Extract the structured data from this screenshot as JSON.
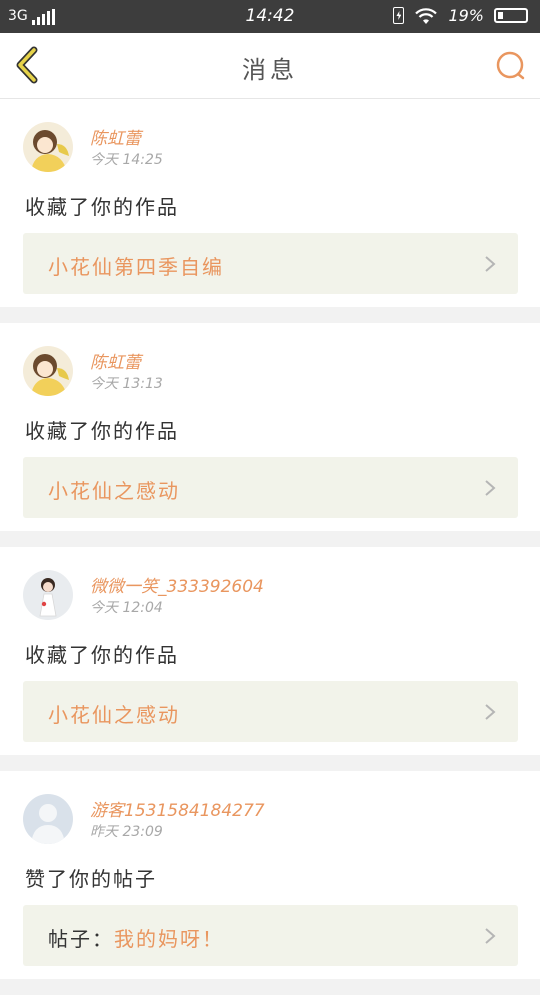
{
  "status_bar": {
    "network": "3G",
    "time": "14:42",
    "battery_level": "19%",
    "battery_fill_fraction": 0.19,
    "icons": [
      "signal-icon",
      "battery-charge-icon",
      "wifi-icon",
      "battery-icon"
    ]
  },
  "header": {
    "title": "消息",
    "back_icon": "chevron-left-icon",
    "search_icon": "search-icon"
  },
  "colors": {
    "accent": "#e9965f",
    "back_arrow": "#e6d34a",
    "card_link_bg": "#f2f3ea",
    "status_bar_bg": "#3d3d3d"
  },
  "notifications": [
    {
      "name": "陈虹蕾",
      "time": "今天 14:25",
      "action": "收藏了你的作品",
      "link_prefix": "",
      "link_title": "小花仙第四季自编",
      "avatar": "cartoon-girl-avatar"
    },
    {
      "name": "陈虹蕾",
      "time": "今天 13:13",
      "action": "收藏了你的作品",
      "link_prefix": "",
      "link_title": "小花仙之感动",
      "avatar": "cartoon-girl-avatar"
    },
    {
      "name": "微微一笑_333392604",
      "time": "今天 12:04",
      "action": "收藏了你的作品",
      "link_prefix": "",
      "link_title": "小花仙之感动",
      "avatar": "doll-photo-avatar"
    },
    {
      "name": "游客1531584184277",
      "time": "昨天 23:09",
      "action": "赞了你的帖子",
      "link_prefix": "帖子：",
      "link_title": "我的妈呀！",
      "avatar": "default-user-avatar"
    }
  ]
}
